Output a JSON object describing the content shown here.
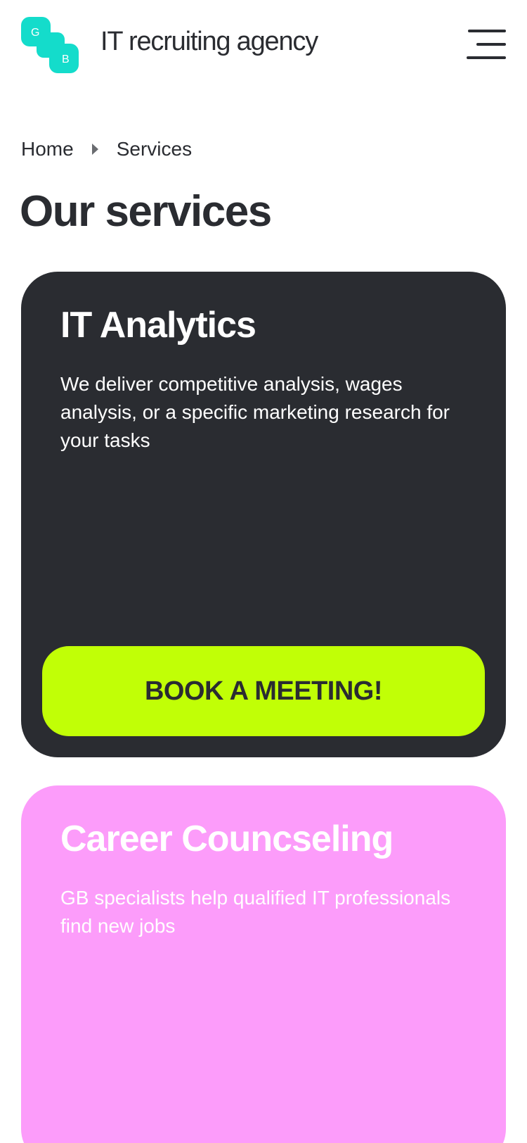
{
  "header": {
    "logo_letters": [
      "G",
      "B"
    ],
    "brand": "IT recruiting agency",
    "menu_icon": "hamburger-menu-icon"
  },
  "breadcrumb": {
    "items": [
      "Home",
      "Services"
    ],
    "separator_icon": "chevron-right-icon"
  },
  "page_title": "Our services",
  "services": [
    {
      "title": "IT Analytics",
      "description": "We deliver competitive analysis, wages analysis, or a specific marketing research for your tasks",
      "button_label": "BOOK A MEETING!",
      "background": "#2a2c31"
    },
    {
      "title": "Career Councseling",
      "description": "GB specialists help qualified IT professionals find new jobs",
      "background": "#fc9cfa"
    }
  ],
  "colors": {
    "logo": "#14dccb",
    "accent_button": "#c1ff06",
    "text_dark": "#2a2c31"
  }
}
